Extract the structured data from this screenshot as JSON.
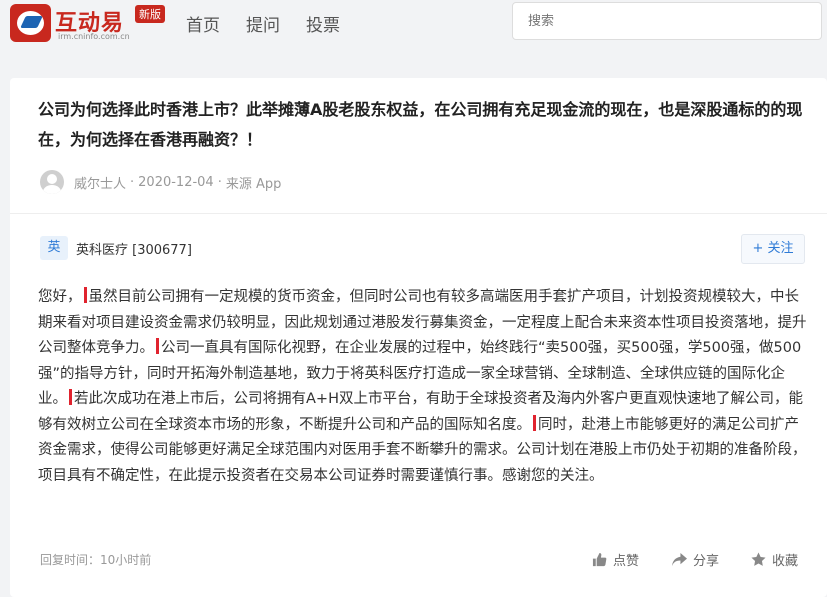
{
  "header": {
    "logo_text": "互动易",
    "logo_sub": "irm.cninfo.com.cn",
    "logo_badge": "新版",
    "nav": [
      "首页",
      "提问",
      "投票"
    ],
    "search_placeholder": "搜索"
  },
  "question": {
    "title": "公司为何选择此时香港上市？此举摊薄A股老股东权益，在公司拥有充足现金流的现在，也是深股通标的的现在，为何选择在香港再融资？！",
    "asker": "威尔士人",
    "date": "2020-12-04",
    "source": "来源 App"
  },
  "company": {
    "icon_text": "英",
    "name": "英科医疗 [300677]",
    "follow_label": "+ 关注"
  },
  "answer": {
    "segments": [
      "您好，",
      "虽然目前公司拥有一定规模的货币资金，但同时公司也有较多高端医用手套扩产项目，计划投资规模较大，中长期来看对项目建设资金需求仍较明显，因此规划通过港股发行募集资金，一定程度上配合未来资本性项目投资落地，提升公司整体竞争力。",
      "公司一直具有国际化视野，在企业发展的过程中，始终践行“卖500强，买500强，学500强，做500强”的指导方针，同时开拓海外制造基地，致力于将英科医疗打造成一家全球营销、全球制造、全球供应链的国际化企业。",
      "若此次成功在港上市后，公司将拥有A+H双上市平台，有助于全球投资者及海内外客户更直观快速地了解公司，能够有效树立公司在全球资本市场的形象，不断提升公司和产品的国际知名度。",
      "同时，赴港上市能够更好的满足公司扩产资金需求，使得公司能够更好满足全球范围内对医用手套不断攀升的需求。公司计划在港股上市仍处于初期的准备阶段，项目具有不确定性，在此提示投资者在交易本公司证券时需要谨慎行事。感谢您的关注。"
    ],
    "reply_time": "回复时间：10小时前",
    "like_label": "点赞",
    "share_label": "分享",
    "collect_label": "收藏"
  },
  "colors": {
    "brand_red": "#c8281e",
    "link_blue": "#2f7bd6",
    "marker_red": "#e0232e"
  }
}
